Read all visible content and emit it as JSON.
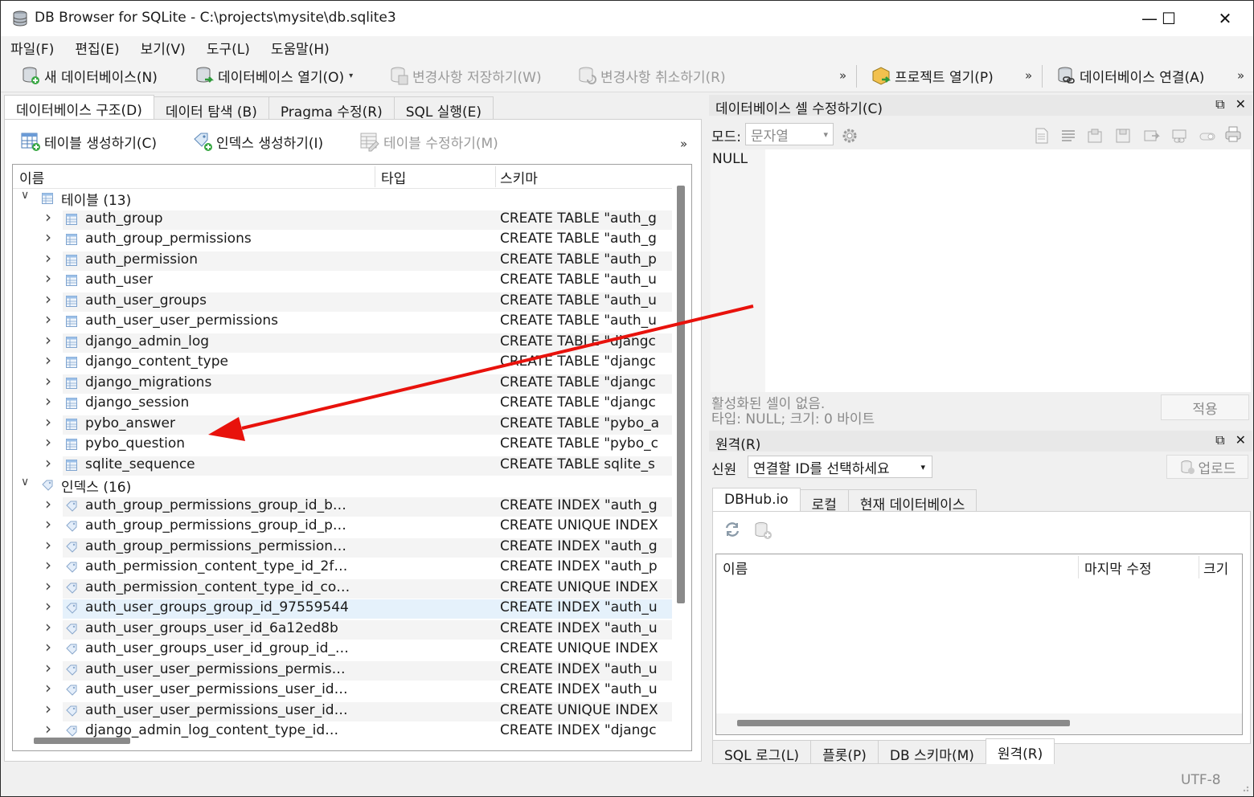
{
  "window": {
    "title": "DB Browser for SQLite - C:\\projects\\mysite\\db.sqlite3",
    "minimize": "—",
    "maximize": "☐",
    "close": "✕"
  },
  "menu": [
    "파일(F)",
    "편집(E)",
    "보기(V)",
    "도구(L)",
    "도움말(H)"
  ],
  "toolbar": {
    "new_db": "새 데이터베이스(N)",
    "open_db": "데이터베이스 열기(O)",
    "save_changes": "변경사항 저장하기(W)",
    "revert_changes": "변경사항 취소하기(R)",
    "more": "»",
    "open_project": "프로젝트 열기(P)",
    "attach_db": "데이터베이스 연결(A)"
  },
  "left_tabs": [
    "데이터베이스 구조(D)",
    "데이터 탐색 (B)",
    "Pragma 수정(R)",
    "SQL 실행(E)"
  ],
  "structure_toolbar": {
    "create_table": "테이블 생성하기(C)",
    "create_index": "인덱스 생성하기(I)",
    "modify_table": "테이블 수정하기(M)",
    "more": "»"
  },
  "tree": {
    "columns": [
      "이름",
      "타입",
      "스키마"
    ],
    "tables_label": "테이블 (13)",
    "tables": [
      {
        "name": "auth_group",
        "schema": "CREATE TABLE \"auth_g"
      },
      {
        "name": "auth_group_permissions",
        "schema": "CREATE TABLE \"auth_g"
      },
      {
        "name": "auth_permission",
        "schema": "CREATE TABLE \"auth_p"
      },
      {
        "name": "auth_user",
        "schema": "CREATE TABLE \"auth_u"
      },
      {
        "name": "auth_user_groups",
        "schema": "CREATE TABLE \"auth_u"
      },
      {
        "name": "auth_user_user_permissions",
        "schema": "CREATE TABLE \"auth_u"
      },
      {
        "name": "django_admin_log",
        "schema": "CREATE TABLE \"djangc"
      },
      {
        "name": "django_content_type",
        "schema": "CREATE TABLE \"djangc"
      },
      {
        "name": "django_migrations",
        "schema": "CREATE TABLE \"djangc"
      },
      {
        "name": "django_session",
        "schema": "CREATE TABLE \"djangc"
      },
      {
        "name": "pybo_answer",
        "schema": "CREATE TABLE \"pybo_a"
      },
      {
        "name": "pybo_question",
        "schema": "CREATE TABLE \"pybo_c"
      },
      {
        "name": "sqlite_sequence",
        "schema": "CREATE TABLE sqlite_s"
      }
    ],
    "indexes_label": "인덱스 (16)",
    "indexes": [
      {
        "name": "auth_group_permissions_group_id_b…",
        "schema": "CREATE INDEX \"auth_g"
      },
      {
        "name": "auth_group_permissions_group_id_p…",
        "schema": "CREATE UNIQUE INDEX"
      },
      {
        "name": "auth_group_permissions_permission…",
        "schema": "CREATE INDEX \"auth_g"
      },
      {
        "name": "auth_permission_content_type_id_2f…",
        "schema": "CREATE INDEX \"auth_p"
      },
      {
        "name": "auth_permission_content_type_id_co…",
        "schema": "CREATE UNIQUE INDEX"
      },
      {
        "name": "auth_user_groups_group_id_97559544",
        "schema": "CREATE INDEX \"auth_u"
      },
      {
        "name": "auth_user_groups_user_id_6a12ed8b",
        "schema": "CREATE INDEX \"auth_u"
      },
      {
        "name": "auth_user_groups_user_id_group_id_…",
        "schema": "CREATE UNIQUE INDEX"
      },
      {
        "name": "auth_user_user_permissions_permis…",
        "schema": "CREATE INDEX \"auth_u"
      },
      {
        "name": "auth_user_user_permissions_user_id…",
        "schema": "CREATE INDEX \"auth_u"
      },
      {
        "name": "auth_user_user_permissions_user_id…",
        "schema": "CREATE UNIQUE INDEX"
      },
      {
        "name": "django_admin_log_content_type_id…",
        "schema": "CREATE INDEX \"djangc"
      }
    ]
  },
  "cell_editor": {
    "title": "데이터베이스 셀 수정하기(C)",
    "mode_label": "모드:",
    "mode_value": "문자열",
    "value": "NULL",
    "status_line1": "활성화된 셀이 없음.",
    "status_line2": "타입: NULL; 크기: 0 바이트",
    "apply": "적용"
  },
  "remote": {
    "title": "원격(R)",
    "identity_label": "신원",
    "identity_placeholder": "연결할 ID를 선택하세요",
    "upload": "업로드",
    "tabs": [
      "DBHub.io",
      "로컬",
      "현재 데이터베이스"
    ],
    "columns": [
      "이름",
      "마지막 수정",
      "크기"
    ]
  },
  "bottom_tabs": [
    "SQL 로그(L)",
    "플롯(P)",
    "DB 스키마(M)",
    "원격(R)"
  ],
  "status": {
    "encoding": "UTF-8"
  },
  "annotation": {
    "arrow_color": "#e8120c"
  }
}
